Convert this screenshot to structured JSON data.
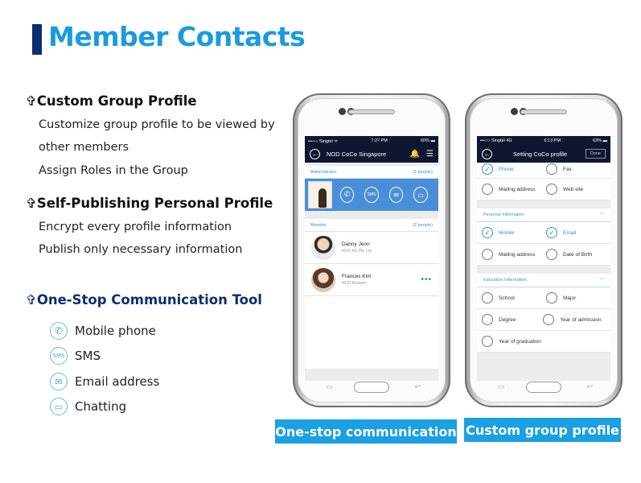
{
  "page": {
    "title": "Member Contacts"
  },
  "left": {
    "sections": [
      {
        "cross": "✞",
        "title": "Custom Group Profile",
        "items": [
          "Customize group profile to be viewed by",
          "other members",
          "Assign Roles in the Group"
        ]
      },
      {
        "cross": "✞",
        "title": "Self-Publishing Personal Profile",
        "items": [
          "Encrypt every profile information",
          "Publish only necessary information"
        ]
      },
      {
        "cross": "✞",
        "title": "One-Stop Communication Tool",
        "items": []
      }
    ],
    "comm_tools": [
      {
        "icon": "phone-icon",
        "label": "Mobile phone",
        "glyph": "✆"
      },
      {
        "icon": "sms-icon",
        "label": "SMS",
        "glyph": "SMS"
      },
      {
        "icon": "email-icon",
        "label": "Email address",
        "glyph": "✉"
      },
      {
        "icon": "chat-icon",
        "label": "Chatting",
        "glyph": "▭"
      }
    ]
  },
  "phone1": {
    "status_left": "•••○○ Singtel ᯤ",
    "status_time": "7:27 PM",
    "status_right": "60% ▬",
    "app_title": "NOD CoCo Singapore",
    "admin_label": "Administrator",
    "admin_count": "(1 people)",
    "member_label": "Member",
    "member_count": "(2 people)",
    "members": [
      {
        "name": "Danny Jeon",
        "company": "NOD Biz Pte Ltd"
      },
      {
        "name": "Frances Kim",
        "company": "NOD Bioware"
      }
    ],
    "admin_actions": [
      "✆",
      "SMS",
      "✉",
      "▭"
    ]
  },
  "phone2": {
    "status_left": "•••○○ Singtel  4G",
    "status_time": "6:13 PM",
    "status_right": "63% ▬",
    "app_title": "Setting CoCo profile",
    "done_label": "Done",
    "top_rows": [
      [
        {
          "label": "Phone",
          "checked": true
        },
        {
          "label": "Fax",
          "checked": false
        }
      ],
      [
        {
          "label": "Mailing address",
          "checked": false
        },
        {
          "label": "Web site",
          "checked": false
        }
      ]
    ],
    "personal_header": "Personal Information",
    "personal_rows": [
      [
        {
          "label": "Mobile",
          "checked": true
        },
        {
          "label": "Email",
          "checked": true
        }
      ],
      [
        {
          "label": "Mailing address",
          "checked": false
        },
        {
          "label": "Date of Birth",
          "checked": false
        }
      ]
    ],
    "education_header": "Education Information",
    "education_rows": [
      [
        {
          "label": "School",
          "checked": false
        },
        {
          "label": "Major",
          "checked": false
        }
      ],
      [
        {
          "label": "Degree",
          "checked": false
        },
        {
          "label": "Year of admission",
          "checked": false
        }
      ],
      [
        {
          "label": "Year of graduation",
          "checked": false
        }
      ]
    ]
  },
  "captions": {
    "left": "One-stop communication",
    "right": "Custom group profile"
  },
  "colors": {
    "title_blue": "#1a9be0",
    "navy": "#0d2f6e",
    "caption_blue": "#1aa0e3",
    "accent": "#3a8fd6"
  }
}
